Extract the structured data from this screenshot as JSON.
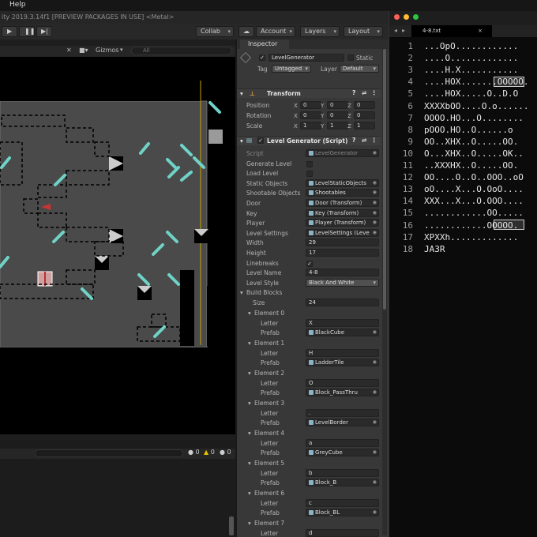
{
  "menubar": {
    "help": "Help"
  },
  "unity": {
    "title": "ity 2019.3.14f1 [PREVIEW PACKAGES IN USE] <Metal>",
    "toolbar": {
      "collab": "Collab",
      "account": "Account",
      "layers": "Layers",
      "layout": "Layout"
    },
    "scene": {
      "gizmos": "Gizmos",
      "search_placeholder": "All"
    },
    "console": {
      "counts": [
        "0",
        "0",
        "0"
      ]
    }
  },
  "inspector": {
    "tab": "Inspector",
    "object_name": "LevelGenerator",
    "static_label": "Static",
    "tag_label": "Tag",
    "tag": "Untagged",
    "layer_label": "Layer",
    "layer": "Default",
    "transform": {
      "title": "Transform",
      "position_label": "Position",
      "rotation_label": "Rotation",
      "scale_label": "Scale",
      "axes": [
        "X",
        "Y",
        "Z"
      ],
      "position": [
        "0",
        "0",
        "0"
      ],
      "rotation": [
        "0",
        "0",
        "0"
      ],
      "scale": [
        "1",
        "1",
        "1"
      ]
    },
    "script_title": "Level Generator (Script)",
    "props": [
      {
        "label": "Script",
        "value": "LevelGenerator",
        "kind": "obj"
      },
      {
        "label": "Generate Level",
        "value": "",
        "kind": "chk"
      },
      {
        "label": "Load Level",
        "value": "",
        "kind": "chk"
      },
      {
        "label": "Static Objects",
        "value": "LevelStaticObjects",
        "kind": "obj"
      },
      {
        "label": "Shootable Objects",
        "value": "Shootables",
        "kind": "obj"
      },
      {
        "label": "Door",
        "value": "Door (Transform)",
        "kind": "obj"
      },
      {
        "label": "Key",
        "value": "Key (Transform)",
        "kind": "obj"
      },
      {
        "label": "Player",
        "value": "Player (Transform)",
        "kind": "obj"
      },
      {
        "label": "Level Settings",
        "value": "LevelSettings (Leve",
        "kind": "obj"
      },
      {
        "label": "Width",
        "value": "29",
        "kind": "txt"
      },
      {
        "label": "Height",
        "value": "17",
        "kind": "txt"
      },
      {
        "label": "Linebreaks",
        "value": "✓",
        "kind": "chk"
      },
      {
        "label": "Level Name",
        "value": "4-8",
        "kind": "txt"
      },
      {
        "label": "Level Style",
        "value": "Black And White",
        "kind": "sel"
      }
    ],
    "build_blocks": {
      "title": "Build Blocks",
      "size_label": "Size",
      "size": "24",
      "letter_label": "Letter",
      "prefab_label": "Prefab",
      "elements": [
        {
          "name": "Element 0",
          "letter": "X",
          "prefab": "BlackCube"
        },
        {
          "name": "Element 1",
          "letter": "H",
          "prefab": "LadderTile"
        },
        {
          "name": "Element 2",
          "letter": "O",
          "prefab": "Block_PassThru"
        },
        {
          "name": "Element 3",
          "letter": ".",
          "prefab": "LevelBorder"
        },
        {
          "name": "Element 4",
          "letter": "a",
          "prefab": "GreyCube"
        },
        {
          "name": "Element 5",
          "letter": "b",
          "prefab": "Block_B"
        },
        {
          "name": "Element 6",
          "letter": "c",
          "prefab": "Block_BL"
        },
        {
          "name": "Element 7",
          "letter": "d",
          "prefab": ""
        }
      ]
    }
  },
  "editor": {
    "tab": "4-8.txt",
    "lines": [
      {
        "n": "1",
        "t": "...OpO............"
      },
      {
        "n": "2",
        "t": "....O............."
      },
      {
        "n": "3",
        "t": "....H.X..........."
      },
      {
        "n": "4",
        "t": "....HOX.......OOOOO."
      },
      {
        "n": "5",
        "t": "....HOX.....O..D.O"
      },
      {
        "n": "6",
        "t": "XXXXbOO....O.o......"
      },
      {
        "n": "7",
        "t": "OOOO.HO...O........"
      },
      {
        "n": "8",
        "t": "pOOO.HO..O......o"
      },
      {
        "n": "9",
        "t": "OO..XHX..O.....OO."
      },
      {
        "n": "10",
        "t": "O...XHX..O.....OK.."
      },
      {
        "n": "11",
        "t": "..XXXHX..O.....OO."
      },
      {
        "n": "12",
        "t": "OO....O..O..OOO..oO"
      },
      {
        "n": "13",
        "t": "oO....X...O.OoO...."
      },
      {
        "n": "14",
        "t": "XXX...X...O.OOO...."
      },
      {
        "n": "15",
        "t": "............OO....."
      },
      {
        "n": "16",
        "t": "............OOOOO."
      },
      {
        "n": "17",
        "t": "XPXXh............."
      },
      {
        "n": "18",
        "t": "JA3R"
      }
    ]
  },
  "colors": {
    "bg": "#000000",
    "panel": "#383838",
    "scene_gray": "#4a4a4a",
    "cyan": "#6fd3c7"
  }
}
